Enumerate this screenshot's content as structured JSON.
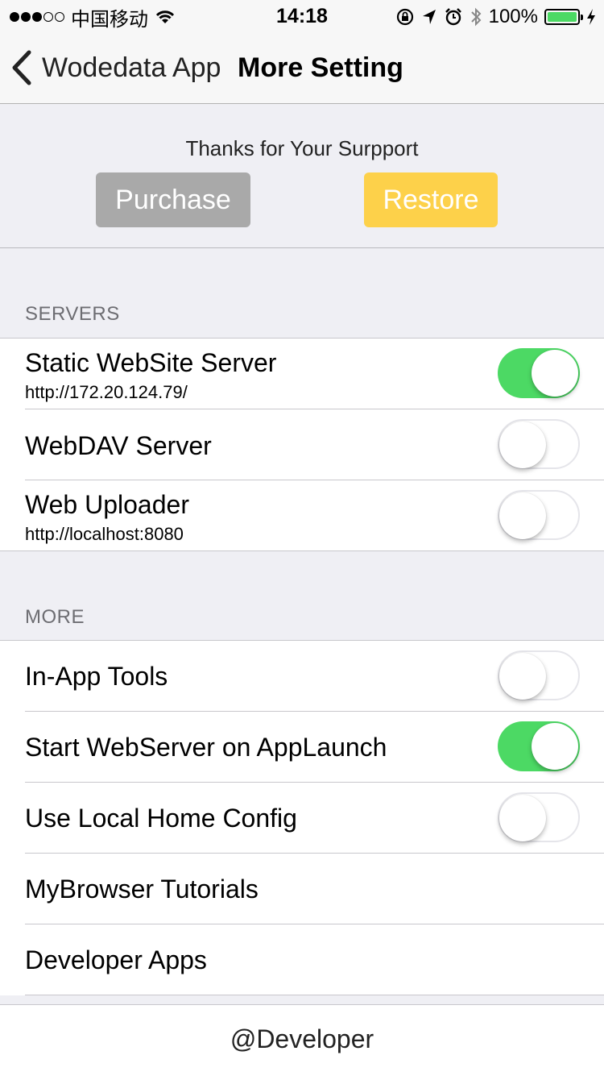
{
  "status_bar": {
    "carrier": "中国移动",
    "time": "14:18",
    "battery": "100%",
    "battery_color": "#4cd964",
    "icons": [
      "wifi-icon",
      "orientation-lock-icon",
      "location-icon",
      "alarm-icon",
      "bluetooth-icon",
      "charging-icon"
    ]
  },
  "nav": {
    "back_label": "Wodedata App",
    "title": "More Setting"
  },
  "purchase": {
    "thanks": "Thanks for Your Surpport",
    "purchase_label": "Purchase",
    "restore_label": "Restore",
    "purchase_color": "#a9a9a9",
    "restore_color": "#fdd14a"
  },
  "servers": {
    "header": "SERVERS",
    "rows": [
      {
        "title": "Static WebSite Server",
        "subtitle": "http://172.20.124.79/",
        "on": true
      },
      {
        "title": "WebDAV Server",
        "on": false
      },
      {
        "title": "Web Uploader",
        "subtitle": "http://localhost:8080",
        "on": false
      }
    ]
  },
  "more": {
    "header": "MORE",
    "rows": [
      {
        "title": "In-App Tools",
        "on": false
      },
      {
        "title": "Start WebServer on AppLaunch",
        "on": true
      },
      {
        "title": "Use Local Home Config",
        "on": false
      },
      {
        "title": "MyBrowser Tutorials"
      },
      {
        "title": "Developer Apps"
      }
    ]
  },
  "footer": {
    "text": "@Developer"
  },
  "colors": {
    "toggle_on": "#4cd964",
    "background": "#efeff4"
  }
}
